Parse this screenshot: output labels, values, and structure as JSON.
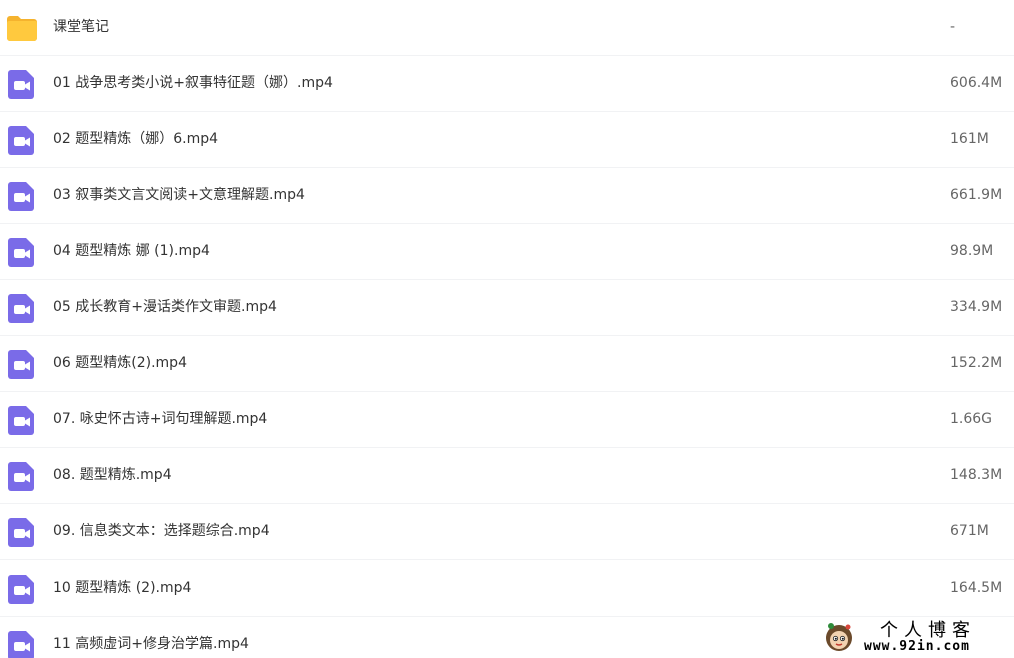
{
  "files": [
    {
      "name": "课堂笔记",
      "size": "-",
      "type": "folder"
    },
    {
      "name": "01 战争思考类小说+叙事特征题（娜）.mp4",
      "size": "606.4M",
      "type": "video"
    },
    {
      "name": "02 题型精炼（娜）6.mp4",
      "size": "161M",
      "type": "video"
    },
    {
      "name": "03 叙事类文言文阅读+文意理解题.mp4",
      "size": "661.9M",
      "type": "video"
    },
    {
      "name": "04 题型精炼 娜 (1).mp4",
      "size": "98.9M",
      "type": "video"
    },
    {
      "name": "05 成长教育+漫话类作文审题.mp4",
      "size": "334.9M",
      "type": "video"
    },
    {
      "name": "06 题型精炼(2).mp4",
      "size": "152.2M",
      "type": "video"
    },
    {
      "name": "07. 咏史怀古诗+词句理解题.mp4",
      "size": "1.66G",
      "type": "video"
    },
    {
      "name": "08. 题型精炼.mp4",
      "size": "148.3M",
      "type": "video"
    },
    {
      "name": "09. 信息类文本：选择题综合.mp4",
      "size": "671M",
      "type": "video"
    },
    {
      "name": "10 题型精炼 (2).mp4",
      "size": "164.5M",
      "type": "video"
    },
    {
      "name": "11 高频虚词+修身治学篇.mp4",
      "size": "",
      "type": "video"
    }
  ],
  "icons": {
    "folder": "folder-icon",
    "video": "video-file-icon"
  },
  "colors": {
    "folder": "#FFC93E",
    "folder_tab": "#F5B32E",
    "video": "#7A6BE8"
  },
  "watermark": {
    "title": "个人博客",
    "url": "www.92in.com"
  }
}
